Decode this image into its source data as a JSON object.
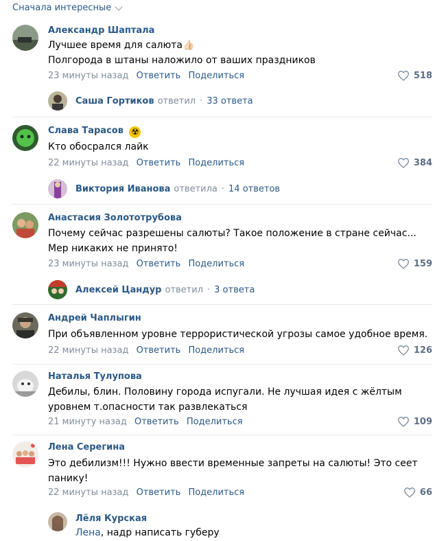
{
  "sort": {
    "label": "Сначала интересные"
  },
  "actions": {
    "reply": "Ответить",
    "share": "Поделиться"
  },
  "comments": [
    {
      "author": "Александр Шаптала",
      "lines": [
        "Лучшее время для салюта👍🏻",
        "Полгорода в штаны наложило от ваших праздников"
      ],
      "time": "23 минуты назад",
      "likes": "518",
      "reply": {
        "name": "Саша Гортиков",
        "verb": "ответил",
        "count": "33 ответа"
      }
    },
    {
      "author": "Слава Тарасов",
      "author_badge": "☢",
      "lines": [
        "Кто обосрался лайк"
      ],
      "time": "22 минуты назад",
      "likes": "384",
      "reply": {
        "name": "Виктория Иванова",
        "verb": "ответила",
        "count": "14 ответов"
      }
    },
    {
      "author": "Анастасия Золототрубова",
      "lines": [
        "Почему сейчас разрешены салюты? Такое положение в стране сейчас...",
        "Мер никаких не принято!"
      ],
      "time": "23 минуты назад",
      "likes": "159",
      "reply": {
        "name": "Алексей Цандур",
        "verb": "ответил",
        "count": "3 ответа"
      }
    },
    {
      "author": "Андрей Чаплыгин",
      "lines": [
        "При объявленном уровне террористической угрозы самое удобное время."
      ],
      "time": "22 минуты назад",
      "likes": "126"
    },
    {
      "author": "Наталья Тулупова",
      "lines": [
        "Дебилы, блин. Половину города испугали. Не лучшая идея с жёлтым",
        "уровнем т.опасности так развлекаться"
      ],
      "time": "21 минуту назад",
      "likes": "109"
    },
    {
      "author": "Лена Серегина",
      "lines": [
        "Это дебилизм!!! Нужно ввести временные запреты на салюты! Это сеет",
        "панику!"
      ],
      "time": "22 минуты назад",
      "likes": "66"
    }
  ],
  "nested_reply": {
    "author": "Лёля Курская",
    "mention": "Лена",
    "text": ", надр написать губеру"
  },
  "colors": {
    "link": "#2a5885",
    "meta": "#818c99",
    "divider": "#e7e8ec"
  }
}
